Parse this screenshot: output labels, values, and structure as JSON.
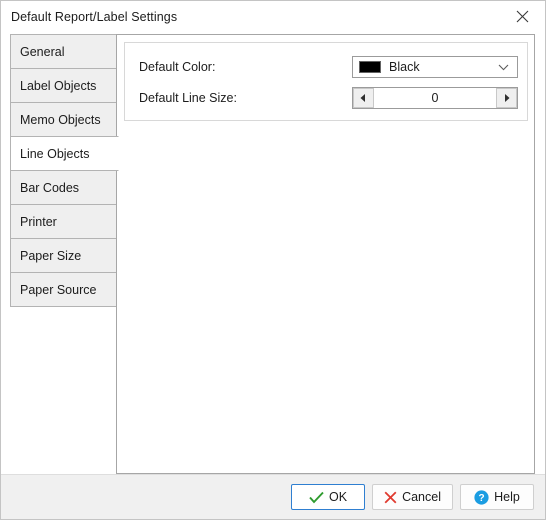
{
  "window": {
    "title": "Default Report/Label Settings",
    "close_icon": "close-icon"
  },
  "tabs": [
    {
      "label": "General",
      "active": false
    },
    {
      "label": "Label Objects",
      "active": false
    },
    {
      "label": "Memo Objects",
      "active": false
    },
    {
      "label": "Line Objects",
      "active": true
    },
    {
      "label": "Bar Codes",
      "active": false
    },
    {
      "label": "Printer",
      "active": false
    },
    {
      "label": "Paper Size",
      "active": false
    },
    {
      "label": "Paper Source",
      "active": false
    }
  ],
  "form": {
    "color": {
      "label": "Default Color:",
      "value": "Black",
      "swatch_hex": "#000000",
      "arrow_icon": "chevron-down-icon"
    },
    "line_size": {
      "label": "Default Line Size:",
      "value": "0",
      "decrement_icon": "triangle-left-icon",
      "increment_icon": "triangle-right-icon"
    }
  },
  "footer": {
    "ok": {
      "label": "OK",
      "icon": "check-icon",
      "icon_hex": "#2e9b2e"
    },
    "cancel": {
      "label": "Cancel",
      "icon": "x-icon",
      "icon_hex": "#e03a2f"
    },
    "help": {
      "label": "Help",
      "icon": "question-circle-icon",
      "icon_hex": "#1b9de2"
    }
  }
}
